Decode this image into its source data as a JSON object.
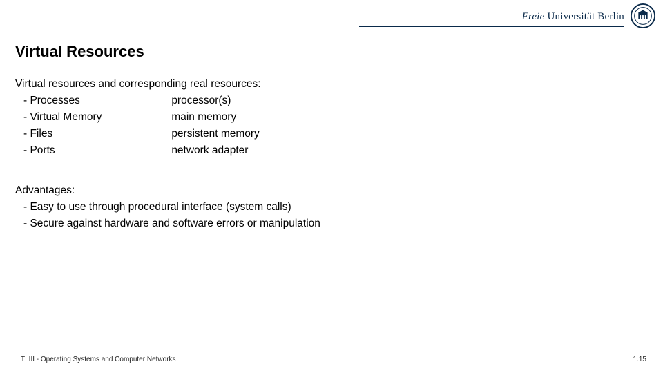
{
  "header": {
    "brand_pre": "Freie",
    "brand_mid": " Universität ",
    "brand_post": "Berlin"
  },
  "title": "Virtual Resources",
  "lead": {
    "pre": "Virtual resources and corresponding ",
    "underlined": "real",
    "post": " resources:"
  },
  "rows": [
    {
      "left": "- Processes",
      "right": "processor(s)"
    },
    {
      "left": "- Virtual Memory",
      "right": "main memory"
    },
    {
      "left": "- Files",
      "right": "persistent memory"
    },
    {
      "left": "- Ports",
      "right": "network adapter"
    }
  ],
  "advantages": {
    "heading": "Advantages:",
    "items": [
      "- Easy to use through procedural interface (system calls)",
      "- Secure against hardware and software errors or manipulation"
    ]
  },
  "footer": {
    "left": "TI III - Operating Systems and Computer Networks",
    "right": "1.15"
  }
}
